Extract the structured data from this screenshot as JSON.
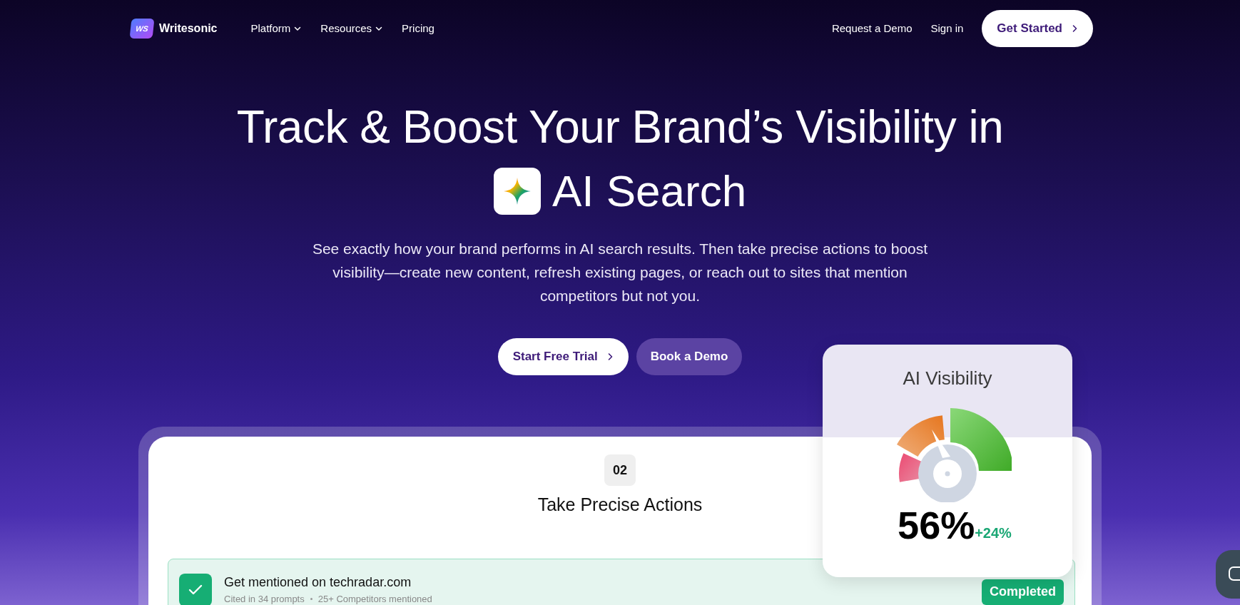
{
  "nav": {
    "brand": {
      "mark": "WS",
      "name": "Writesonic"
    },
    "links": [
      {
        "label": "Platform",
        "dropdown": true
      },
      {
        "label": "Resources",
        "dropdown": true
      },
      {
        "label": "Pricing",
        "dropdown": false
      }
    ],
    "right_links": [
      "Request a Demo",
      "Sign in"
    ],
    "cta": "Get Started"
  },
  "hero": {
    "title_line_1": "Track & Boost Your Brand’s Visibility in",
    "title_line_2": "AI Search",
    "description": "See exactly how your brand performs in AI search results. Then take precise actions to boost visibility—create new content, refresh existing pages, or reach out to sites that mention competitors but not you.",
    "buttons": [
      {
        "label": "Start Free Trial",
        "kind": "primary"
      },
      {
        "label": "Book a Demo",
        "kind": "secondary"
      }
    ]
  },
  "steps_card": {
    "step_number": "02",
    "step_title": "Take Precise Actions",
    "actions": [
      {
        "title": "Get mentioned on techradar.com",
        "details": [
          "Cited in 34 prompts",
          "25+ Competitors mentioned"
        ],
        "checked": true,
        "status": "Completed"
      }
    ]
  },
  "visibility_card": {
    "title": "AI Visibility",
    "value": "56%",
    "change": "+24%"
  }
}
